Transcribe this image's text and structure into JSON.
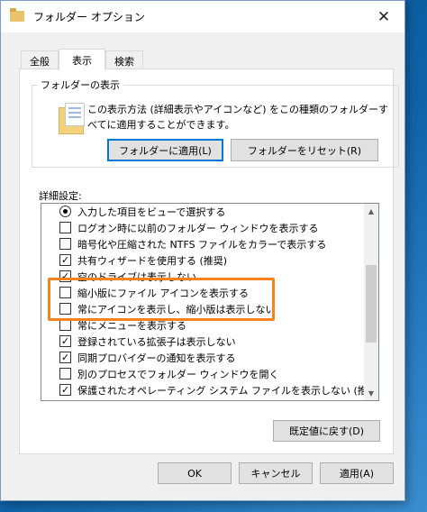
{
  "window": {
    "title": "フォルダー オプション",
    "close_glyph": "✕"
  },
  "tabs": [
    {
      "label": "全般",
      "active": false
    },
    {
      "label": "表示",
      "active": true
    },
    {
      "label": "検索",
      "active": false
    }
  ],
  "folder_views": {
    "group_title": "フォルダーの表示",
    "description": "この表示方法 (詳細表示やアイコンなど) をこの種類のフォルダーすべてに適用することができます。",
    "apply_button": "フォルダーに適用(L)",
    "reset_button": "フォルダーをリセット(R)"
  },
  "advanced": {
    "label": "詳細設定:",
    "items": [
      {
        "type": "radio",
        "label": "入力した項目をビューで選択する",
        "checked": true
      },
      {
        "type": "checkbox",
        "label": "ログオン時に以前のフォルダー ウィンドウを表示する",
        "checked": false
      },
      {
        "type": "checkbox",
        "label": "暗号化や圧縮された NTFS ファイルをカラーで表示する",
        "checked": false
      },
      {
        "type": "checkbox",
        "label": "共有ウィザードを使用する (推奨)",
        "checked": true
      },
      {
        "type": "checkbox",
        "label": "空のドライブは表示しない",
        "checked": true
      },
      {
        "type": "checkbox",
        "label": "縮小版にファイル アイコンを表示する",
        "checked": false
      },
      {
        "type": "checkbox",
        "label": "常にアイコンを表示し、縮小版は表示しない",
        "checked": false
      },
      {
        "type": "checkbox",
        "label": "常にメニューを表示する",
        "checked": false
      },
      {
        "type": "checkbox",
        "label": "登録されている拡張子は表示しない",
        "checked": true
      },
      {
        "type": "checkbox",
        "label": "同期プロバイダーの通知を表示する",
        "checked": true
      },
      {
        "type": "checkbox",
        "label": "別のプロセスでフォルダー ウィンドウを開く",
        "checked": false
      },
      {
        "type": "checkbox",
        "label": "保護されたオペレーティング システム ファイルを表示しない (推奨)",
        "checked": true
      }
    ],
    "restore_button": "既定値に戻す(D)"
  },
  "footer": {
    "ok": "OK",
    "cancel": "キャンセル",
    "apply": "適用(A)"
  },
  "colors": {
    "highlight_frame": "#f5821f",
    "default_button_border": "#0078d7"
  },
  "icons": [
    "folder-icon",
    "close-icon",
    "scroll-up-icon",
    "scroll-down-icon"
  ]
}
